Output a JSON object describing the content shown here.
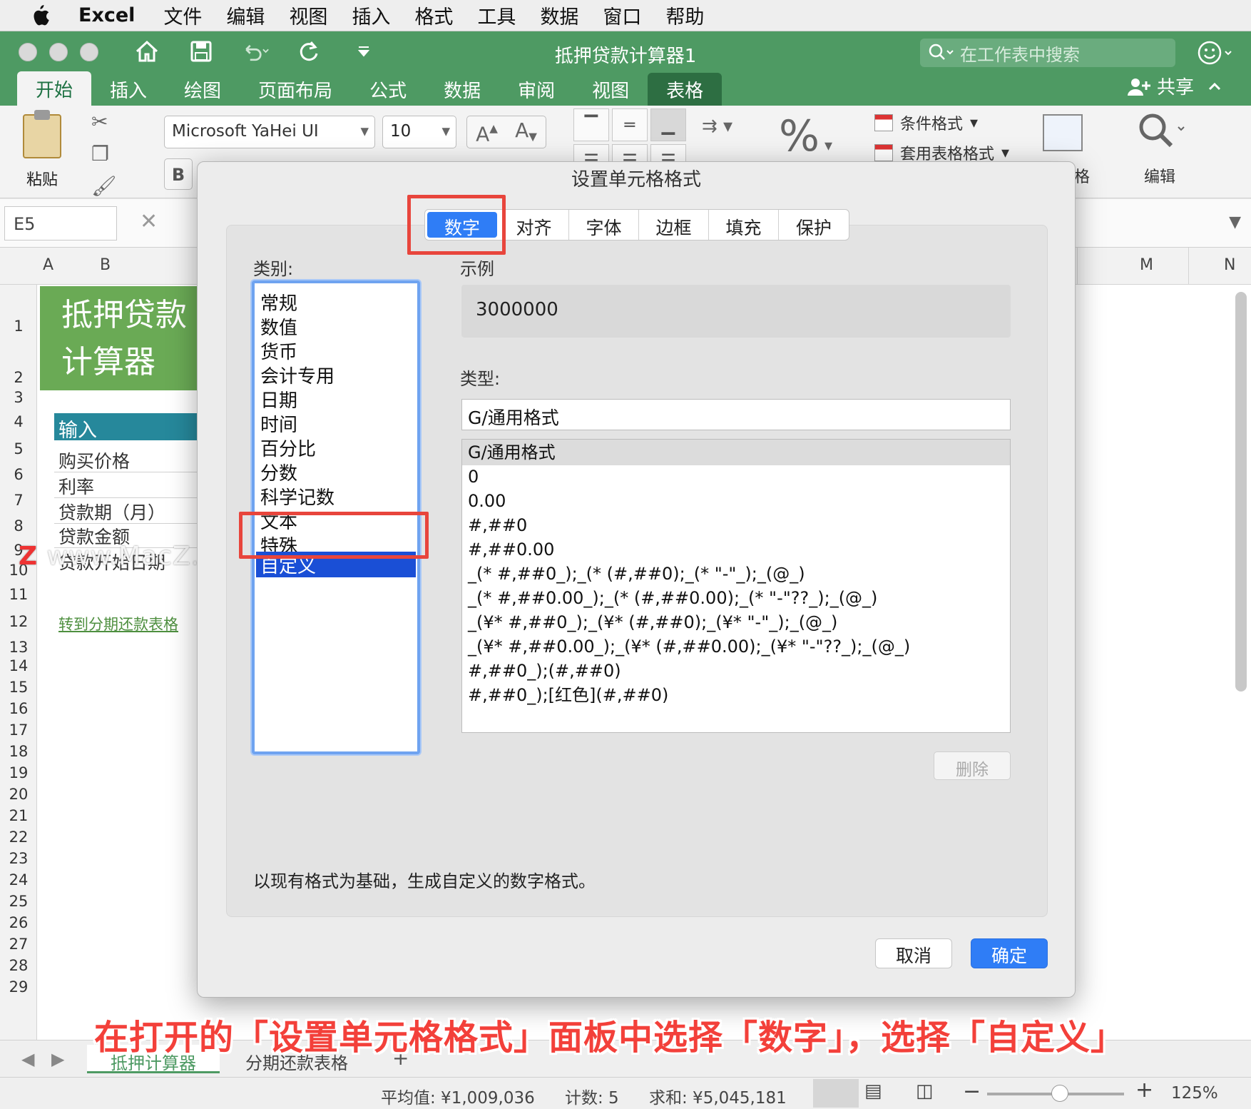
{
  "menubar": {
    "app": "Excel",
    "items": [
      "文件",
      "编辑",
      "视图",
      "插入",
      "格式",
      "工具",
      "数据",
      "窗口",
      "帮助"
    ]
  },
  "window": {
    "title": "抵押贷款计算器1",
    "search_placeholder": "在工作表中搜索",
    "share_label": "共享"
  },
  "ribbon": {
    "tabs": [
      "开始",
      "插入",
      "绘图",
      "页面布局",
      "公式",
      "数据",
      "审阅",
      "视图",
      "表格"
    ],
    "paste_label": "粘贴",
    "font_name": "Microsoft YaHei UI",
    "font_size": "10",
    "bold_label": "B",
    "percent_label": "%",
    "conditional_format": "条件格式",
    "table_format": "套用表格格式",
    "cells_label": "格",
    "edit_label": "编辑"
  },
  "formulabar": {
    "namebox": "E5"
  },
  "sheet": {
    "columns": [
      "A",
      "B",
      "M",
      "N"
    ],
    "rows": [
      "1",
      "2",
      "3",
      "4",
      "5",
      "6",
      "7",
      "8",
      "9",
      "10",
      "11",
      "12",
      "13",
      "14",
      "15",
      "16",
      "17",
      "18",
      "19",
      "20",
      "21",
      "22",
      "23",
      "24",
      "25",
      "26",
      "27",
      "28",
      "29"
    ],
    "title_line1": "抵押贷款",
    "title_line2": "计算器",
    "input_header": "输入",
    "labels": [
      "购买价格",
      "利率",
      "贷款期（月）",
      "贷款金额",
      "贷款开始日期"
    ],
    "link": "转到分期还款表格",
    "watermark": "www.MacZ.com",
    "watermark_logo": "Z"
  },
  "sheet_tabs": [
    "抵押计算器",
    "分期还款表格"
  ],
  "statusbar": {
    "average": "平均值: ¥1,009,036",
    "count": "计数: 5",
    "sum": "求和: ¥5,045,181",
    "zoom": "125%"
  },
  "dialog": {
    "title": "设置单元格格式",
    "tabs": [
      "数字",
      "对齐",
      "字体",
      "边框",
      "填充",
      "保护"
    ],
    "category_label": "类别:",
    "categories": [
      "常规",
      "数值",
      "货币",
      "会计专用",
      "日期",
      "时间",
      "百分比",
      "分数",
      "科学记数",
      "文本",
      "特殊",
      "自定义"
    ],
    "selected_category": "自定义",
    "sample_label": "示例",
    "sample_value": "3000000",
    "type_label": "类型:",
    "type_value": "G/通用格式",
    "formats": [
      "G/通用格式",
      "0",
      "0.00",
      "#,##0",
      "#,##0.00",
      "_(* #,##0_);_(* (#,##0);_(* \"-\"_);_(@_)",
      "_(* #,##0.00_);_(* (#,##0.00);_(* \"-\"??_);_(@_)",
      "_(¥* #,##0_);_(¥* (#,##0);_(¥* \"-\"_);_(@_)",
      "_(¥* #,##0.00_);_(¥* (#,##0.00);_(¥* \"-\"??_);_(@_)",
      "#,##0_);(#,##0)",
      "#,##0_);[红色](#,##0)"
    ],
    "delete_label": "删除",
    "description": "以现有格式为基础，生成自定义的数字格式。",
    "cancel_label": "取消",
    "ok_label": "确定"
  },
  "caption": "在打开的「设置单元格格式」面板中选择「数字」，选择「自定义」",
  "colors": {
    "excel_green": "#4e9a63",
    "accent_blue": "#2f7df6",
    "highlight_red": "#e8453c"
  }
}
